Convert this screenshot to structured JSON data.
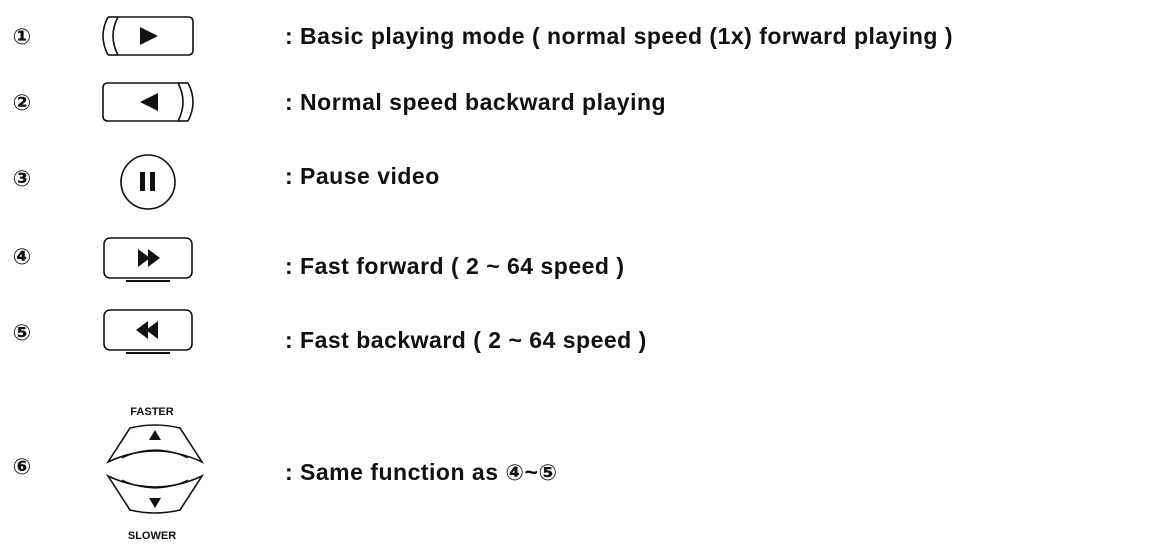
{
  "rows": [
    {
      "num": "①",
      "desc": ": Basic playing mode ( normal speed (1x) forward playing )",
      "icon": "play-icon"
    },
    {
      "num": "②",
      "desc": ": Normal speed backward playing",
      "icon": "reverse-play-icon"
    },
    {
      "num": "③",
      "desc": ": Pause video",
      "icon": "pause-icon"
    },
    {
      "num": "④",
      "desc": ": Fast forward ( 2 ~ 64 speed )",
      "icon": "fast-forward-icon"
    },
    {
      "num": "⑤",
      "desc": ": Fast backward ( 2 ~ 64 speed )",
      "icon": "fast-backward-icon"
    },
    {
      "num": "⑥",
      "desc_prefix": ": Same function as ",
      "ref_a": "④",
      "tilde": "~",
      "ref_b": "⑤",
      "icon": "speed-shuttle-icon"
    }
  ],
  "shuttle": {
    "top_label": "FASTER",
    "bottom_label": "SLOWER"
  }
}
